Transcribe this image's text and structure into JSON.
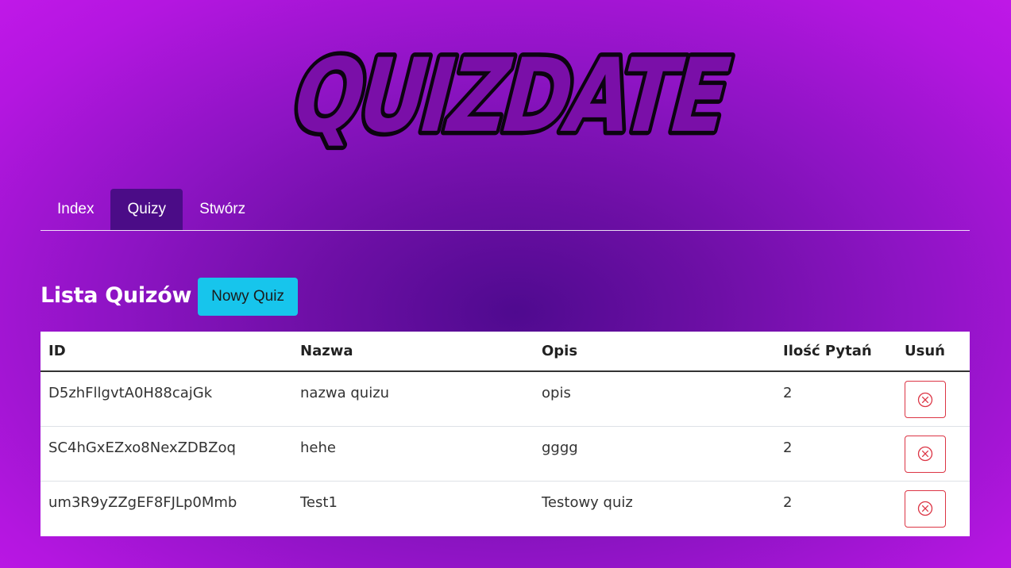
{
  "logo": {
    "text": "QUIZDATE"
  },
  "nav": {
    "items": [
      {
        "label": "Index",
        "active": false
      },
      {
        "label": "Quizy",
        "active": true
      },
      {
        "label": "Stwórz",
        "active": false
      }
    ]
  },
  "main": {
    "title": "Lista Quizów",
    "new_button_label": "Nowy Quiz"
  },
  "table": {
    "headers": [
      "ID",
      "Nazwa",
      "Opis",
      "Ilość Pytań",
      "Usuń"
    ],
    "rows": [
      {
        "id": "D5zhFllgvtA0H88cajGk",
        "name": "nazwa quizu",
        "desc": "opis",
        "count": "2",
        "delete_icon": "x-circle-icon"
      },
      {
        "id": "SC4hGxEZxo8NexZDBZoq",
        "name": "hehe",
        "desc": "gggg",
        "count": "2",
        "delete_icon": "x-circle-icon"
      },
      {
        "id": "um3R9yZZgEF8FJLp0Mmb",
        "name": "Test1",
        "desc": "Testowy quiz",
        "count": "2",
        "delete_icon": "x-circle-icon"
      }
    ]
  },
  "colors": {
    "active_tab": "#4b0c87",
    "primary_button": "#17c5ec",
    "danger": "#dc3545",
    "logo_fill": "#7a0fa8"
  }
}
